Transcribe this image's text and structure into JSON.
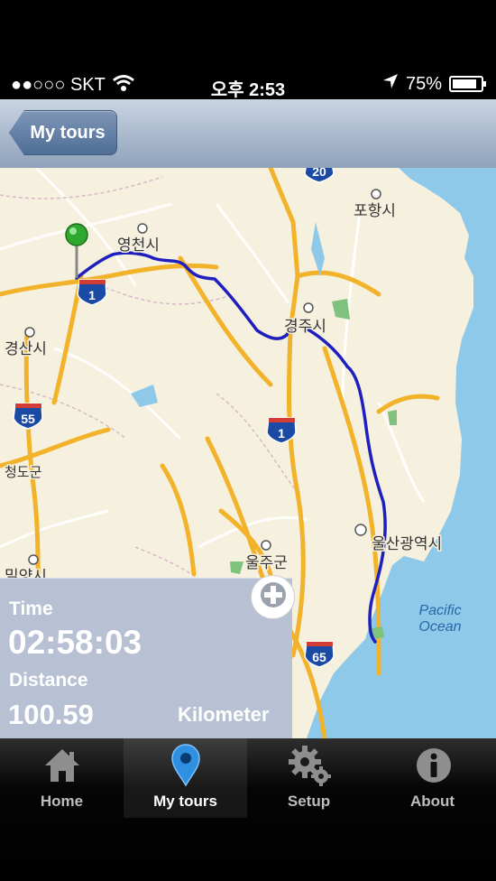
{
  "status_bar": {
    "signal": "●●○○○",
    "carrier": "SKT",
    "time": "오후 2:53",
    "battery": "75%"
  },
  "nav": {
    "back_label": "My tours"
  },
  "map": {
    "labels": {
      "yeongcheon": "영천시",
      "pohang": "포항시",
      "gyeongju": "경주시",
      "gyeongsan": "경산시",
      "cheongdo": "청도군",
      "uljugun": "울주군",
      "ulsan": "울산광역시",
      "miryang": "밀양시",
      "pacific_line1": "Pacific",
      "pacific_line2": "Ocean"
    },
    "shields": {
      "r20": "20",
      "r1a": "1",
      "r55": "55",
      "r1b": "1",
      "r65": "65"
    }
  },
  "panel": {
    "time_label": "Time",
    "time_value": "02:58:03",
    "distance_label": "Distance",
    "distance_value": "100.59",
    "unit": "Kilometer"
  },
  "tabs": [
    {
      "label": "Home",
      "icon": "home-icon"
    },
    {
      "label": "My tours",
      "icon": "map-pin-icon"
    },
    {
      "label": "Setup",
      "icon": "gear-icon"
    },
    {
      "label": "About",
      "icon": "info-icon"
    }
  ],
  "colors": {
    "route": "#1f1fbf",
    "highway": "#f2b22a",
    "sea": "#8ec9ea"
  }
}
